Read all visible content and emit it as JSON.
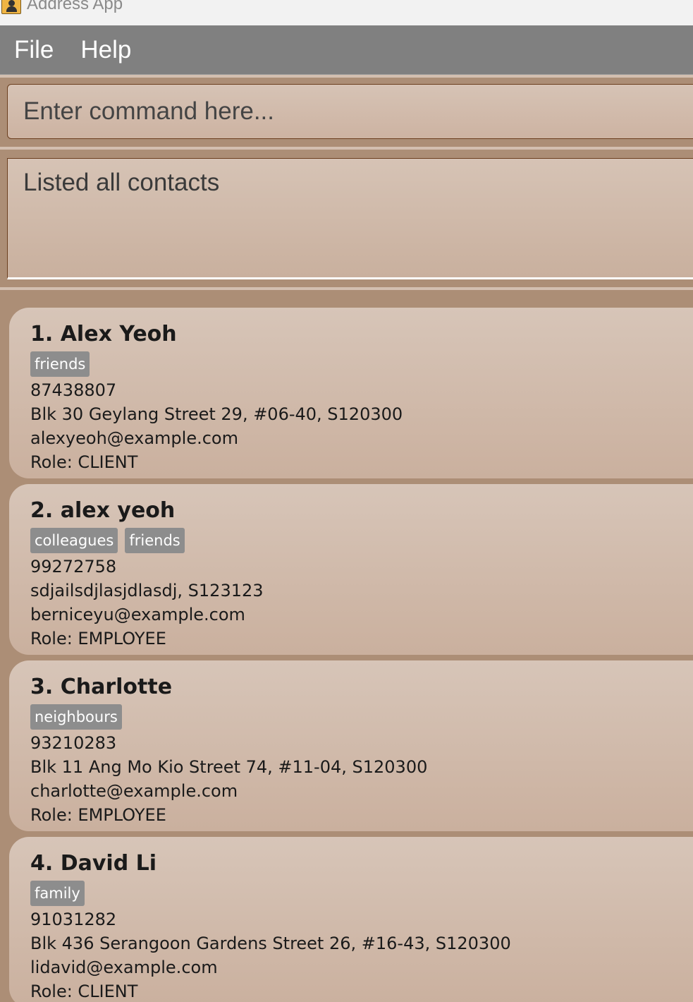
{
  "window": {
    "title": "Address App"
  },
  "menu": {
    "items": [
      "File",
      "Help"
    ]
  },
  "command": {
    "placeholder": "Enter command here...",
    "value": ""
  },
  "result": {
    "text": "Listed all contacts"
  },
  "contacts": [
    {
      "index_name": "1. Alex Yeoh",
      "tags": [
        "friends"
      ],
      "phone": "87438807",
      "address": "Blk 30 Geylang Street 29, #06-40, S120300",
      "email": "alexyeoh@example.com",
      "role": "Role: CLIENT"
    },
    {
      "index_name": "2. alex yeoh",
      "tags": [
        "colleagues",
        "friends"
      ],
      "phone": "99272758",
      "address": "sdjailsdjlasjdlasdj, S123123",
      "email": "berniceyu@example.com",
      "role": "Role: EMPLOYEE"
    },
    {
      "index_name": "3. Charlotte",
      "tags": [
        "neighbours"
      ],
      "phone": "93210283",
      "address": "Blk 11 Ang Mo Kio Street 74, #11-04, S120300",
      "email": "charlotte@example.com",
      "role": "Role: EMPLOYEE"
    },
    {
      "index_name": "4. David Li",
      "tags": [
        "family"
      ],
      "phone": "91031282",
      "address": "Blk 436 Serangoon Gardens Street 26, #16-43, S120300",
      "email": "lidavid@example.com",
      "role": "Role: CLIENT"
    }
  ]
}
